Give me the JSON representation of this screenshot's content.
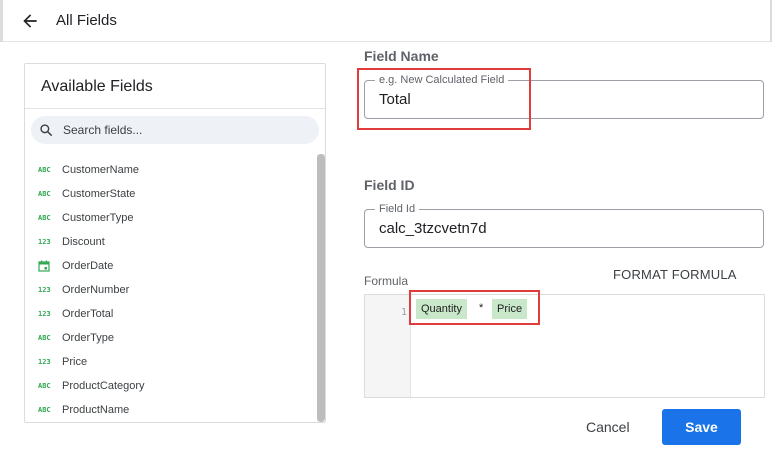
{
  "header": {
    "title": "All Fields",
    "back_icon": "arrow-left-icon"
  },
  "fields_panel": {
    "title": "Available Fields",
    "search": {
      "placeholder": "Search fields...",
      "value": ""
    },
    "items": [
      {
        "type_label": "ABC",
        "type": "text",
        "name": "CustomerName"
      },
      {
        "type_label": "ABC",
        "type": "text",
        "name": "CustomerState"
      },
      {
        "type_label": "ABC",
        "type": "text",
        "name": "CustomerType"
      },
      {
        "type_label": "123",
        "type": "number",
        "name": "Discount"
      },
      {
        "type_label": "",
        "type": "date",
        "name": "OrderDate"
      },
      {
        "type_label": "123",
        "type": "number",
        "name": "OrderNumber"
      },
      {
        "type_label": "123",
        "type": "number",
        "name": "OrderTotal"
      },
      {
        "type_label": "ABC",
        "type": "text",
        "name": "OrderType"
      },
      {
        "type_label": "123",
        "type": "number",
        "name": "Price"
      },
      {
        "type_label": "ABC",
        "type": "text",
        "name": "ProductCategory"
      },
      {
        "type_label": "ABC",
        "type": "text",
        "name": "ProductName"
      }
    ]
  },
  "field_name": {
    "section_label": "Field Name",
    "legend": "e.g. New Calculated Field",
    "value": "Total"
  },
  "field_id": {
    "section_label": "Field ID",
    "legend": "Field Id",
    "value": "calc_3tzcvetn7d"
  },
  "formula": {
    "label": "Formula",
    "format_button": "FORMAT FORMULA",
    "line_number": "1",
    "tokens": {
      "left": "Quantity",
      "operator": "*",
      "right": "Price"
    }
  },
  "footer": {
    "cancel_label": "Cancel",
    "save_label": "Save"
  },
  "colors": {
    "accent": "#1a73e8",
    "type_icon": "#34a853",
    "highlight": "#e03c3c",
    "token_bg": "#c9e7c9"
  }
}
